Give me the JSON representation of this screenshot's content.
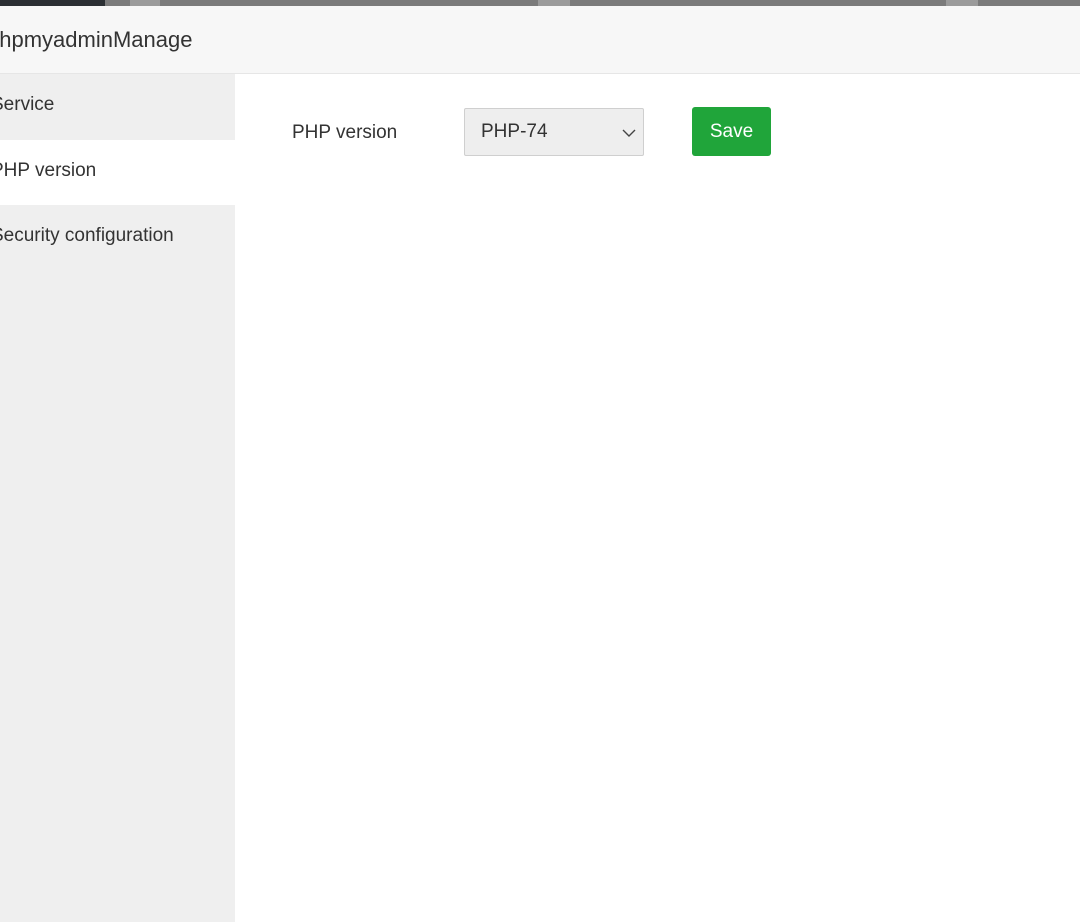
{
  "window": {
    "title": "phpmyadminManage"
  },
  "sidebar": {
    "items": [
      {
        "label": "Service",
        "active": false
      },
      {
        "label": "PHP version",
        "active": true
      },
      {
        "label": "Security configuration",
        "active": false
      }
    ]
  },
  "main": {
    "php_version": {
      "label": "PHP version",
      "selected": "PHP-74",
      "save_label": "Save"
    }
  },
  "colors": {
    "accent": "#20a53a",
    "sidebar_bg": "#efefef",
    "active_item_bg": "#ffffff",
    "titlebar_bg": "#f7f7f7"
  }
}
